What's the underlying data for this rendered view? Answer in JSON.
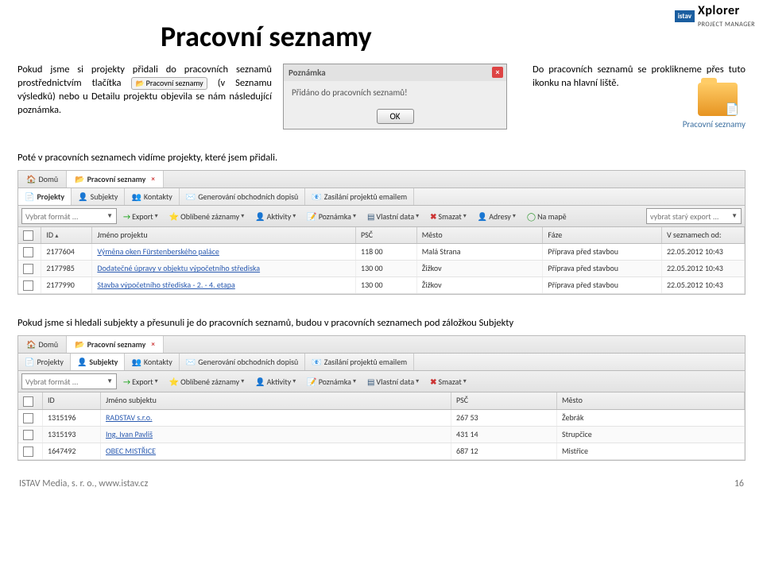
{
  "header": {
    "brand_badge": "istav",
    "brand_name": "Xplorer",
    "brand_sub": "PROJECT MANAGER"
  },
  "title": "Pracovní seznamy",
  "intro_left": {
    "line1a": "Pokud jsme si projekty přidali do pracovních seznamů prostřednictvím tlačítka ",
    "inline_button": "Pracovní seznamy",
    "line1b": " (v Seznamu výsledků) nebo u Detailu projektu objevila se nám následující poznámka."
  },
  "dialog": {
    "title": "Poznámka",
    "body": "Přidáno do pracovních seznamů!",
    "ok": "OK"
  },
  "intro_right": {
    "text": "Do pracovních seznamů se proklikneme přes tuto ikonku na hlavní liště.",
    "icon_label": "Pracovní seznamy"
  },
  "caption1": "Poté v pracovních seznamech vidíme projekty, které jsem přidali.",
  "caption2": "Pokud jsme si hledali subjekty a přesunuli je do pracovních seznamů, budou v pracovních seznamech pod záložkou Subjekty",
  "ss1": {
    "tabs_top": [
      "Domů",
      "Pracovní seznamy"
    ],
    "tabs_sub": [
      "Projekty",
      "Subjekty",
      "Kontakty",
      "Generování obchodních dopisů",
      "Zasílání projektů emailem"
    ],
    "toolbar": {
      "format": "Vybrat formát ...",
      "items": [
        "Export",
        "Oblíbené záznamy",
        "Aktivity",
        "Poznámka",
        "Vlastní data",
        "Smazat",
        "Adresy",
        "Na mapě"
      ],
      "old_export": "vybrat starý export ..."
    },
    "cols": [
      "ID",
      "Jméno projektu",
      "PSČ",
      "Město",
      "Fáze",
      "V seznamech od:"
    ],
    "rows": [
      {
        "id": "2177604",
        "name": "Výměna oken Fürstenberského paláce",
        "psc": "118 00",
        "mesto": "Malá Strana",
        "faze": "Příprava před stavbou",
        "date": "22.05.2012 10:43"
      },
      {
        "id": "2177985",
        "name": "Dodatečné úpravy v objektu výpočetního střediska",
        "psc": "130 00",
        "mesto": "Žižkov",
        "faze": "Příprava před stavbou",
        "date": "22.05.2012 10:43"
      },
      {
        "id": "2177990",
        "name": "Stavba výpočetního střediska - 2. - 4. etapa",
        "psc": "130 00",
        "mesto": "Žižkov",
        "faze": "Příprava před stavbou",
        "date": "22.05.2012 10:43"
      }
    ]
  },
  "ss2": {
    "tabs_top": [
      "Domů",
      "Pracovní seznamy"
    ],
    "tabs_sub": [
      "Projekty",
      "Subjekty",
      "Kontakty",
      "Generování obchodních dopisů",
      "Zasílání projektů emailem"
    ],
    "toolbar": {
      "format": "Vybrat formát ...",
      "items": [
        "Export",
        "Oblíbené záznamy",
        "Aktivity",
        "Poznámka",
        "Vlastní data",
        "Smazat"
      ]
    },
    "cols": [
      "ID",
      "Jméno subjektu",
      "PSČ",
      "Město"
    ],
    "rows": [
      {
        "id": "1315196",
        "name": "RADSTAV s.r.o.",
        "psc": "267 53",
        "mesto": "Žebrák"
      },
      {
        "id": "1315193",
        "name": "Ing. Ivan Pavliš",
        "psc": "431 14",
        "mesto": "Strupčice"
      },
      {
        "id": "1647492",
        "name": "OBEC MISTŘICE",
        "psc": "687 12",
        "mesto": "Mistřice"
      }
    ]
  },
  "footer": {
    "left": "ISTAV Media, s. r. o., www.istav.cz",
    "right": "16"
  }
}
